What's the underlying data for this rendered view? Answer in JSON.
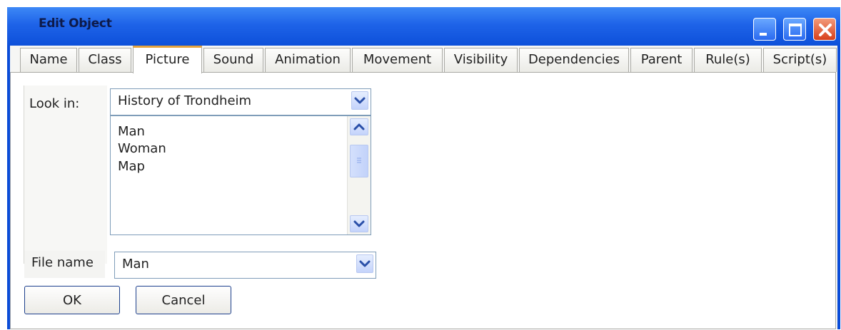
{
  "window": {
    "title": "Edit Object"
  },
  "tabs": [
    {
      "label": "Name"
    },
    {
      "label": "Class"
    },
    {
      "label": "Picture"
    },
    {
      "label": "Sound"
    },
    {
      "label": "Animation"
    },
    {
      "label": "Movement"
    },
    {
      "label": "Visibility"
    },
    {
      "label": "Dependencies"
    },
    {
      "label": "Parent"
    },
    {
      "label": "Rule(s)"
    },
    {
      "label": "Script(s)"
    }
  ],
  "active_tab": "Picture",
  "picture": {
    "look_in_label": "Look in:",
    "look_in_value": "History of Trondheim",
    "items": [
      "Man",
      "Woman",
      "Map"
    ],
    "file_name_label": "File name",
    "file_name_value": "Man",
    "ok_label": "OK",
    "cancel_label": "Cancel"
  },
  "icons": {
    "minimize": "minimize-icon",
    "maximize": "maximize-icon",
    "close": "close-icon",
    "dropdown": "chevron-down-icon",
    "scroll_up": "chevron-up-icon",
    "scroll_down": "chevron-down-icon"
  },
  "colors": {
    "titlebar": "#1e63e8",
    "close_button": "#d8401c",
    "active_tab_accent": "#e4a23c",
    "field_border": "#7f9db9"
  }
}
